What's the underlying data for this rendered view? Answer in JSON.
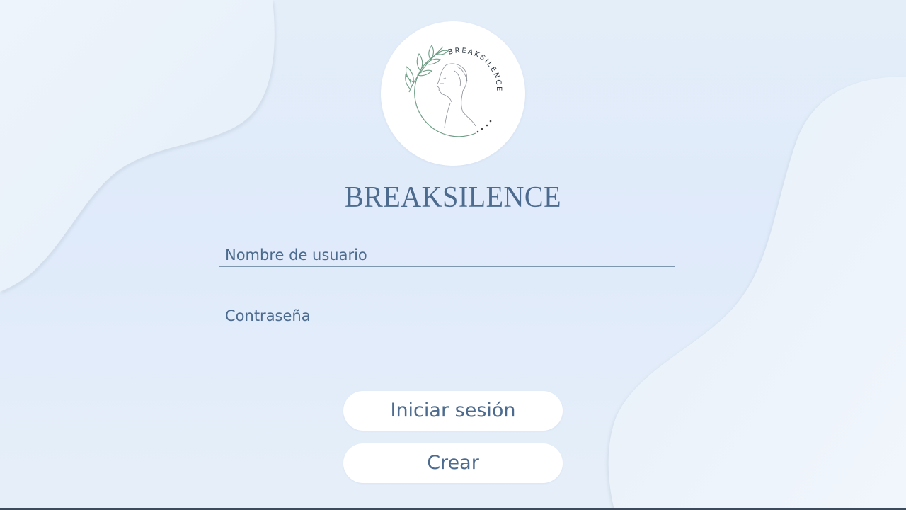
{
  "app": {
    "title": "BREAKSILENCE",
    "logo_text": "BREAKSILENCE"
  },
  "form": {
    "username_placeholder": "Nombre de usuario",
    "password_placeholder": "Contraseña"
  },
  "actions": {
    "login_label": "Iniciar sesión",
    "create_label": "Crear"
  },
  "colors": {
    "text": "#4d6b8e",
    "background": "#e2edfa",
    "button": "#ffffff",
    "logo_leaf": "#6f9e86"
  }
}
